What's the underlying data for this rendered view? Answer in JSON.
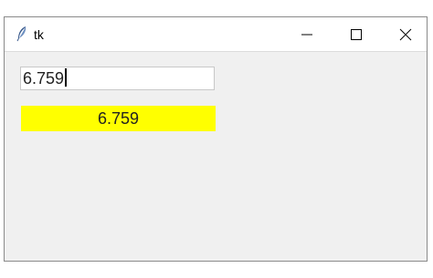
{
  "window": {
    "title": "tk",
    "icon": "feather-icon",
    "controls": [
      "minimize-icon",
      "maximize-icon",
      "close-icon"
    ]
  },
  "entry": {
    "value": "6.759"
  },
  "label": {
    "text": "6.759",
    "background": "#ffff00"
  }
}
